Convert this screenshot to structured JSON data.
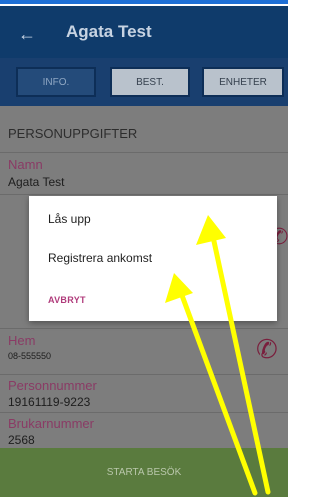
{
  "header": {
    "title": "Agata Test",
    "back_icon": "arrow-left-icon"
  },
  "tabs": [
    {
      "label": "INFO.",
      "active": true
    },
    {
      "label": "BEST.",
      "active": false
    },
    {
      "label": "ENHETER",
      "active": false
    }
  ],
  "section_title": "PERSONUPPGIFTER",
  "fields": [
    {
      "label": "Namn",
      "value": "Agata Test"
    },
    {
      "label": "Hem",
      "value": "08-555550"
    },
    {
      "label": "Personnummer",
      "value": "19161119-9223"
    },
    {
      "label": "Brukarnummer",
      "value": "2568"
    }
  ],
  "dialog": {
    "options": [
      "Lås upp",
      "Registrera ankomst"
    ],
    "cancel": "AVBRYT"
  },
  "bottom_button": "STARTA BESÖK",
  "colors": {
    "appbar": "#0f3b6b",
    "accent": "#b03b7b",
    "annotation_arrow": "#ffff00"
  }
}
